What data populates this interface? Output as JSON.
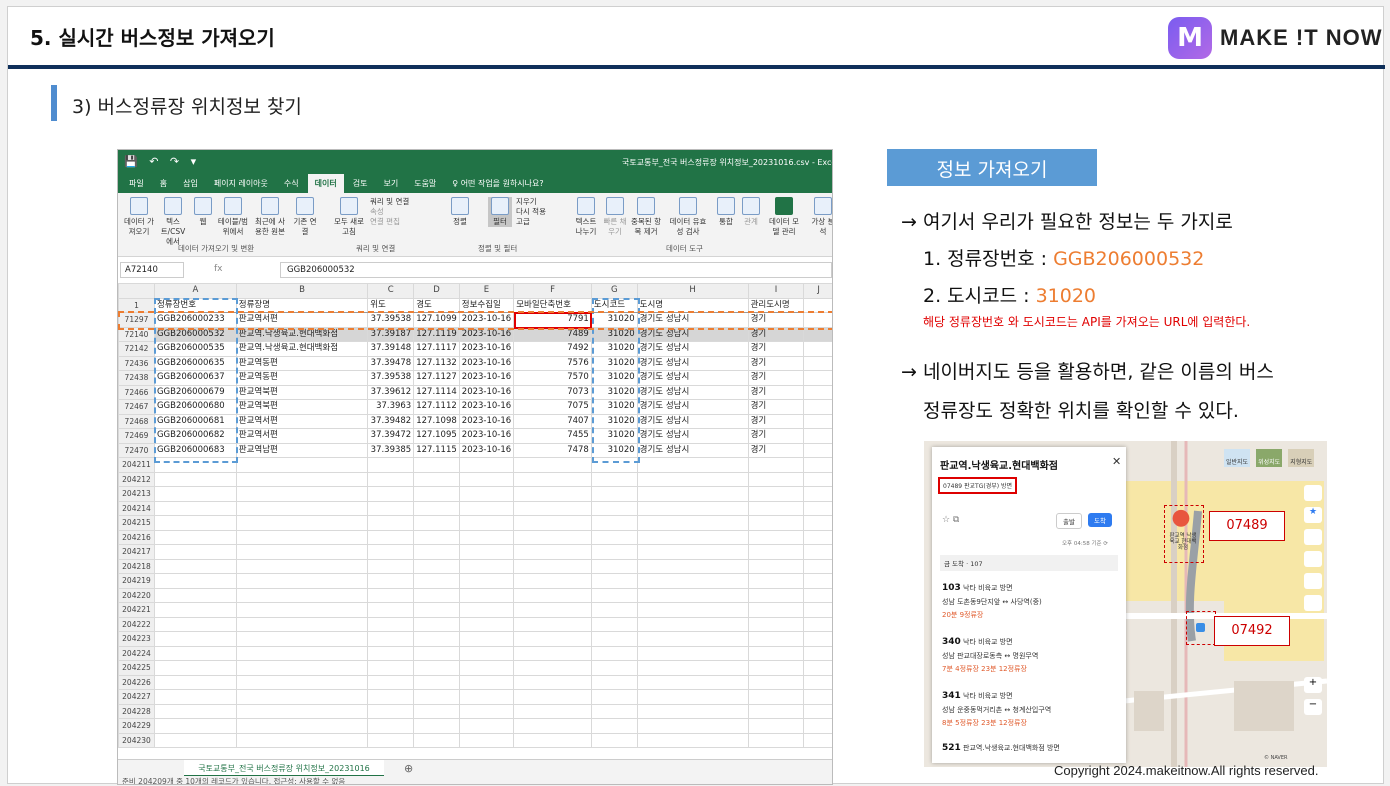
{
  "slide": {
    "title": "5. 실시간 버스정보 가져오기",
    "brand": "MAKE !T NOW",
    "brand_logo": "M",
    "subtitle": "3) 버스정류장 위치정보 찾기",
    "copyright": "Copyright 2024.makeitnow.All rights reserved."
  },
  "excel": {
    "quick_access": "💾 ↶ ↷ ▾",
    "file_name": "국토교통부_전국 버스정류장 위치정보_20231016.csv - Excel",
    "tabs": [
      "파일",
      "홈",
      "삽입",
      "페이지 레이아웃",
      "수식",
      "데이터",
      "검토",
      "보기",
      "도움말",
      "♀ 어떤 작업을 원하시나요?"
    ],
    "active_tab": "데이터",
    "ribbon_buttons": [
      "데이터 가져오기",
      "텍스트/CSV에서",
      "웹",
      "테이블/범위에서",
      "최근에 사용한 원본",
      "기존 연결",
      "모두 새로고침",
      "정렬",
      "필터",
      "텍스트 나누기",
      "빠른 채우기",
      "중복된 항목 제거",
      "데이터 유효성 검사",
      "통합",
      "관계",
      "데이터 모델 관리",
      "가상 분석"
    ],
    "ribbon_small": [
      "쿼리 및 연결",
      "속성",
      "연결 편집",
      "지우기",
      "다시 적용",
      "고급"
    ],
    "ribbon_groups": [
      "데이터 가져오기 및 변환",
      "쿼리 및 연결",
      "정렬 및 필터",
      "데이터 도구"
    ],
    "name_box": "A72140",
    "fx": "fx",
    "formula_value": "GGB206000532",
    "col_headers": [
      "A",
      "B",
      "C",
      "D",
      "E",
      "F",
      "G",
      "H",
      "I",
      "J"
    ],
    "header_row_num": "1",
    "field_headers": [
      "정류장번호",
      "정류장명",
      "위도",
      "경도",
      "정보수집일",
      "모바일단축번호",
      "도시코드",
      "도시명",
      "관리도시명"
    ],
    "rows": [
      {
        "n": "71297",
        "c": [
          "GGB206000233",
          "판교역서편",
          "37.39538",
          "127.1099",
          "2023-10-16",
          "7791",
          "31020",
          "경기도 성남시",
          "경기"
        ]
      },
      {
        "n": "72140",
        "c": [
          "GGB206000532",
          "판교역.낙생육교.현대백화점",
          "37.39187",
          "127.1119",
          "2023-10-16",
          "7489",
          "31020",
          "경기도 성남시",
          "경기"
        ]
      },
      {
        "n": "72142",
        "c": [
          "GGB206000535",
          "판교역.낙생육교.현대백화점",
          "37.39148",
          "127.1117",
          "2023-10-16",
          "7492",
          "31020",
          "경기도 성남시",
          "경기"
        ]
      },
      {
        "n": "72436",
        "c": [
          "GGB206000635",
          "판교역동편",
          "37.39478",
          "127.1132",
          "2023-10-16",
          "7576",
          "31020",
          "경기도 성남시",
          "경기"
        ]
      },
      {
        "n": "72438",
        "c": [
          "GGB206000637",
          "판교역동편",
          "37.39538",
          "127.1127",
          "2023-10-16",
          "7570",
          "31020",
          "경기도 성남시",
          "경기"
        ]
      },
      {
        "n": "72466",
        "c": [
          "GGB206000679",
          "판교역북편",
          "37.39612",
          "127.1114",
          "2023-10-16",
          "7073",
          "31020",
          "경기도 성남시",
          "경기"
        ]
      },
      {
        "n": "72467",
        "c": [
          "GGB206000680",
          "판교역북편",
          "37.3963",
          "127.1112",
          "2023-10-16",
          "7075",
          "31020",
          "경기도 성남시",
          "경기"
        ]
      },
      {
        "n": "72468",
        "c": [
          "GGB206000681",
          "판교역서편",
          "37.39482",
          "127.1098",
          "2023-10-16",
          "7407",
          "31020",
          "경기도 성남시",
          "경기"
        ]
      },
      {
        "n": "72469",
        "c": [
          "GGB206000682",
          "판교역서편",
          "37.39472",
          "127.1095",
          "2023-10-16",
          "7455",
          "31020",
          "경기도 성남시",
          "경기"
        ]
      },
      {
        "n": "72470",
        "c": [
          "GGB206000683",
          "판교역남편",
          "37.39385",
          "127.1115",
          "2023-10-16",
          "7478",
          "31020",
          "경기도 성남시",
          "경기"
        ]
      }
    ],
    "empty_rows": [
      "204211",
      "204212",
      "204213",
      "204214",
      "204215",
      "204216",
      "204217",
      "204218",
      "204219",
      "204220",
      "204221",
      "204222",
      "204223",
      "204224",
      "204225",
      "204226",
      "204227",
      "204228",
      "204229",
      "204230"
    ],
    "sheet_tab": "국토교통부_전국 버스정류장 위치정보_20231016",
    "add_sheet": "⊕",
    "status": "준비    204209개 중 10개의 레코드가 있습니다.     접근성: 사용할 수 없음"
  },
  "info": {
    "heading": "정보 가져오기",
    "line1": "→ 여기서 우리가 필요한 정보는 두 가지로",
    "item1_label": "1. 정류장번호 : ",
    "item1_value": "GGB206000532",
    "item2_label": "2. 도시코드 : ",
    "item2_value": "31020",
    "note": "해당 정류장번호 와 도시코드는 API를 가져오는 URL에 입력한다.",
    "line3": "→ 네이버지도 등을 활용하면, 같은 이름의 버스",
    "line4": "정류장도 정확한 위치를 확인할 수 있다."
  },
  "map": {
    "stop_name": "판교역.낙생육교.현대백화점",
    "stop_id": "07489 판교TG(경부) 방면",
    "close": "✕",
    "btn_depart": "출발",
    "btn_arrive": "도착",
    "update_time": "오후 04:58 기준 ⟳",
    "stop_count": "금 도착 · 107",
    "routes": [
      {
        "num": "103",
        "dir": "낙타 비육교 방면",
        "line": "성남  도촌동9단지앞 ↔ 사당역(중)",
        "eta": "20분 9정류장"
      },
      {
        "num": "340",
        "dir": "낙타 비육교 방면",
        "line": "성남  판교대장로동측 ↔ 명원무역",
        "eta": "7분 4정류장  23분 12정류장"
      },
      {
        "num": "341",
        "dir": "낙타 비육교 방면",
        "line": "성남  운중동먹거리촌 ↔ 청계산입구역",
        "eta": "8분 5정류장  23분 12정류장"
      },
      {
        "num": "521",
        "dir": "판교역.낙생육교.현대백화점 방면",
        "line": "",
        "eta": ""
      }
    ],
    "marker_label": "판교역 낙생육교 현대백화점",
    "label_a": "07489",
    "label_b": "07492",
    "map_types": [
      "일반지도",
      "위성지도",
      "지형지도"
    ],
    "naver": "© NAVER"
  },
  "colors": {
    "accent": "#ed7d31",
    "excel_green": "#217346",
    "blue_box": "#5b9bd5",
    "navy": "#0f2f5a",
    "red": "#e00000"
  }
}
